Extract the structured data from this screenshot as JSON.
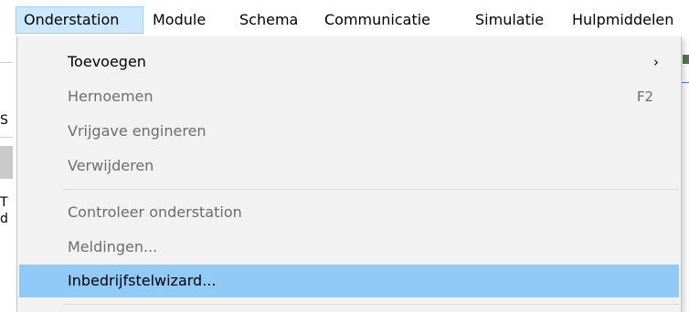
{
  "menubar": {
    "items": [
      {
        "label": "Onderstation",
        "active": true
      },
      {
        "label": "Module"
      },
      {
        "label": "Schema"
      },
      {
        "label": "Communicatie"
      },
      {
        "label": "Simulatie"
      },
      {
        "label": "Hulpmiddelen"
      }
    ]
  },
  "background": {
    "fragments": [
      "S",
      "T",
      "d"
    ]
  },
  "dropdown": {
    "items": [
      {
        "label": "Toevoegen",
        "enabled": true,
        "submenu_icon": "chevron-right-icon",
        "submenu_glyph": "›"
      },
      {
        "label": "Hernoemen",
        "enabled": false,
        "shortcut": "F2"
      },
      {
        "label": "Vrijgave engineren",
        "enabled": false
      },
      {
        "label": "Verwijderen",
        "enabled": false
      },
      {
        "label": "Controleer onderstation",
        "enabled": false
      },
      {
        "label": "Meldingen...",
        "enabled": false
      },
      {
        "label": "Inbedrijfstelwizard...",
        "enabled": true,
        "highlighted": true
      }
    ]
  },
  "colors": {
    "menu_active_bg": "#cce8ff",
    "menu_bg": "#f2f2f2",
    "highlight": "#91c9f7",
    "disabled_text": "#6d6d6d"
  }
}
